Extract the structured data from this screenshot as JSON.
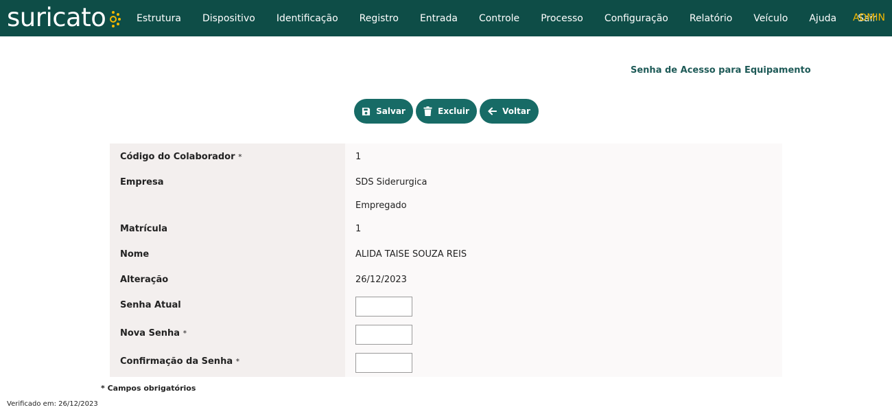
{
  "header": {
    "logo_text": "suricato",
    "nav": [
      "Estrutura",
      "Dispositivo",
      "Identificação",
      "Registro",
      "Entrada",
      "Controle",
      "Processo",
      "Configuração",
      "Relatório",
      "Veículo",
      "Ajuda",
      "Sair"
    ],
    "user": "ADMIN"
  },
  "page": {
    "title": "Senha de Acesso para Equipamento"
  },
  "buttons": {
    "save": "Salvar",
    "delete": "Excluir",
    "back": "Voltar"
  },
  "form": {
    "codigo_label": "Código do Colaborador",
    "codigo_value": "1",
    "empresa_label": "Empresa",
    "empresa_value": "SDS Siderurgica",
    "tipo_value": "Empregado",
    "matricula_label": "Matrícula",
    "matricula_value": "1",
    "nome_label": "Nome",
    "nome_value": "ALIDA TAISE SOUZA REIS",
    "alteracao_label": "Alteração",
    "alteracao_value": "26/12/2023",
    "senha_atual_label": "Senha Atual",
    "nova_senha_label": "Nova Senha",
    "confirmacao_label": "Confirmação da Senha",
    "required_mark": "*"
  },
  "footer": {
    "required_note": "* Campos obrigatórios",
    "verified": "Verificado em: 26/12/2023"
  },
  "colors": {
    "header_bg": "#0e4d47",
    "button_bg": "#176b66",
    "accent": "#f5b800",
    "title": "#1e5a57"
  }
}
